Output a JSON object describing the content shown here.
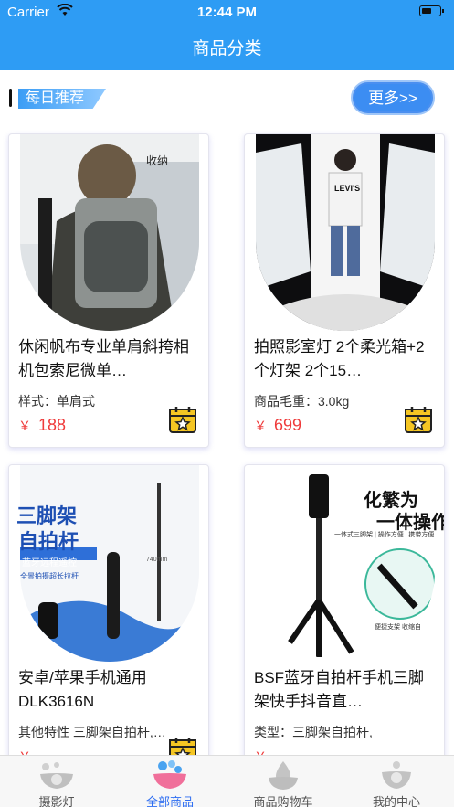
{
  "status": {
    "carrier": "Carrier",
    "time": "12:44 PM"
  },
  "header": {
    "title": "商品分类"
  },
  "section": {
    "title": "每日推荐",
    "more_label": "更多>>"
  },
  "products": [
    {
      "name": "休闲帆布专业单肩斜挎相机包索尼微单…",
      "spec": "样式：单肩式",
      "currency": "￥",
      "price": "188",
      "image_text": "收纳"
    },
    {
      "name": "拍照影室灯 2个柔光箱+2个灯架 2个15…",
      "spec": "商品毛重：3.0kg",
      "currency": "￥",
      "price": "699",
      "image_text": "LEVI'S"
    },
    {
      "name": "安卓/苹果手机通用 DLK3616N",
      "spec": "其他特性 三脚架自拍杆,…",
      "currency": "￥",
      "price": "",
      "image_text_1": "三脚架",
      "image_text_2": "自拍杆",
      "image_text_3": "蓝牙远程遥控",
      "image_text_4": "全景拍摄超长拉杆",
      "image_text_5": "740mm"
    },
    {
      "name": "BSF蓝牙自拍杆手机三脚架快手抖音直…",
      "spec": "类型：三脚架自拍杆,",
      "currency": "￥",
      "price": "",
      "image_text_1": "化繁为",
      "image_text_2": "一体操作",
      "image_text_3": "一体式三脚架 | 操作方便 | 携带方便",
      "image_text_4": "便捷支架 收缩自"
    }
  ],
  "tabs": [
    {
      "label": "摄影灯"
    },
    {
      "label": "全部商品"
    },
    {
      "label": "商品购物车"
    },
    {
      "label": "我的中心"
    }
  ],
  "colors": {
    "primary": "#2e9cf4",
    "price": "#ef3b3b",
    "tab_active": "#2e6ef2"
  }
}
